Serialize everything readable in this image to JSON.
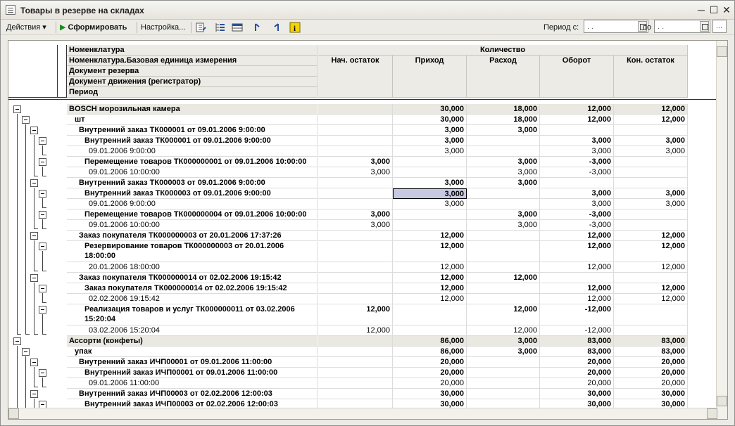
{
  "window": {
    "title": "Товары в резерве на складах"
  },
  "toolbar": {
    "actions_label": "Действия",
    "generate_label": "Сформировать",
    "settings_label": "Настройка...",
    "period_from_label": "Период с:",
    "period_from_value": ". .",
    "period_to_label": "по",
    "period_to_value": ". .",
    "more_label": "..."
  },
  "table": {
    "headers": {
      "nomenclature": "Номенклатура",
      "unit": "Номенклатура.Базовая единица измерения",
      "reserve_doc": "Документ резерва",
      "movement_doc": "Документ движения (регистратор)",
      "period": "Период",
      "quantity": "Количество",
      "columns": [
        "Нач. остаток",
        "Приход",
        "Расход",
        "Оборот",
        "Кон. остаток"
      ]
    },
    "rows": [
      {
        "level": 0,
        "label": "BOSCH морозильная камера",
        "vals": [
          "",
          "30,000",
          "18,000",
          "12,000",
          "12,000"
        ]
      },
      {
        "level": 1,
        "label": "шт",
        "vals": [
          "",
          "30,000",
          "18,000",
          "12,000",
          "12,000"
        ]
      },
      {
        "level": 2,
        "label": "Внутренний заказ ТК000001 от 09.01.2006 9:00:00",
        "vals": [
          "",
          "3,000",
          "3,000",
          "",
          ""
        ]
      },
      {
        "level": 3,
        "label": "Внутренний заказ ТК000001 от 09.01.2006 9:00:00",
        "vals": [
          "",
          "3,000",
          "",
          "3,000",
          "3,000"
        ]
      },
      {
        "level": 4,
        "label": "09.01.2006 9:00:00",
        "vals": [
          "",
          "3,000",
          "",
          "3,000",
          "3,000"
        ]
      },
      {
        "level": 3,
        "label": "Перемещение товаров ТК000000001 от 09.01.2006 10:00:00",
        "vals": [
          "3,000",
          "",
          "3,000",
          "-3,000",
          ""
        ]
      },
      {
        "level": 4,
        "label": "09.01.2006 10:00:00",
        "vals": [
          "3,000",
          "",
          "3,000",
          "-3,000",
          ""
        ]
      },
      {
        "level": 2,
        "label": "Внутренний заказ ТК000003 от 09.01.2006 9:00:00",
        "vals": [
          "",
          "3,000",
          "3,000",
          "",
          ""
        ]
      },
      {
        "level": 3,
        "label": "Внутренний заказ ТК000003 от 09.01.2006 9:00:00",
        "vals": [
          "",
          "3,000",
          "",
          "3,000",
          "3,000"
        ]
      },
      {
        "level": 4,
        "label": "09.01.2006 9:00:00",
        "vals": [
          "",
          "3,000",
          "",
          "3,000",
          "3,000"
        ]
      },
      {
        "level": 3,
        "label": "Перемещение товаров ТК000000004 от 09.01.2006 10:00:00",
        "vals": [
          "3,000",
          "",
          "3,000",
          "-3,000",
          ""
        ]
      },
      {
        "level": 4,
        "label": "09.01.2006 10:00:00",
        "vals": [
          "3,000",
          "",
          "3,000",
          "-3,000",
          ""
        ]
      },
      {
        "level": 2,
        "label": "Заказ покупателя ТК000000003 от 20.01.2006 17:37:26",
        "vals": [
          "",
          "12,000",
          "",
          "12,000",
          "12,000"
        ]
      },
      {
        "level": 3,
        "label": "Резервирование товаров ТК000000003 от 20.01.2006",
        "label2": "18:00:00",
        "vals": [
          "",
          "12,000",
          "",
          "12,000",
          "12,000"
        ]
      },
      {
        "level": 4,
        "label": "20.01.2006 18:00:00",
        "vals": [
          "",
          "12,000",
          "",
          "12,000",
          "12,000"
        ]
      },
      {
        "level": 2,
        "label": "Заказ покупателя ТК000000014 от 02.02.2006 19:15:42",
        "vals": [
          "",
          "12,000",
          "12,000",
          "",
          ""
        ]
      },
      {
        "level": 3,
        "label": "Заказ покупателя ТК000000014 от 02.02.2006 19:15:42",
        "vals": [
          "",
          "12,000",
          "",
          "12,000",
          "12,000"
        ]
      },
      {
        "level": 4,
        "label": "02.02.2006 19:15:42",
        "vals": [
          "",
          "12,000",
          "",
          "12,000",
          "12,000"
        ]
      },
      {
        "level": 3,
        "label": "Реализация товаров и услуг ТК000000011 от 03.02.2006",
        "label2": "15:20:04",
        "vals": [
          "12,000",
          "",
          "12,000",
          "-12,000",
          ""
        ]
      },
      {
        "level": 4,
        "label": "03.02.2006 15:20:04",
        "vals": [
          "12,000",
          "",
          "12,000",
          "-12,000",
          ""
        ]
      },
      {
        "level": 0,
        "label": "Ассорти (конфеты)",
        "vals": [
          "",
          "86,000",
          "3,000",
          "83,000",
          "83,000"
        ]
      },
      {
        "level": 1,
        "label": "упак",
        "vals": [
          "",
          "86,000",
          "3,000",
          "83,000",
          "83,000"
        ]
      },
      {
        "level": 2,
        "label": "Внутренний заказ ИЧП00001 от 09.01.2006 11:00:00",
        "vals": [
          "",
          "20,000",
          "",
          "20,000",
          "20,000"
        ]
      },
      {
        "level": 3,
        "label": "Внутренний заказ ИЧП00001 от 09.01.2006 11:00:00",
        "vals": [
          "",
          "20,000",
          "",
          "20,000",
          "20,000"
        ]
      },
      {
        "level": 4,
        "label": "09.01.2006 11:00:00",
        "vals": [
          "",
          "20,000",
          "",
          "20,000",
          "20,000"
        ]
      },
      {
        "level": 2,
        "label": "Внутренний заказ ИЧП00003 от 02.02.2006 12:00:03",
        "vals": [
          "",
          "30,000",
          "",
          "30,000",
          "30,000"
        ]
      },
      {
        "level": 3,
        "label": "Внутренний заказ ИЧП00003 от 02.02.2006 12:00:03",
        "vals": [
          "",
          "30,000",
          "",
          "30,000",
          "30,000"
        ]
      }
    ]
  }
}
